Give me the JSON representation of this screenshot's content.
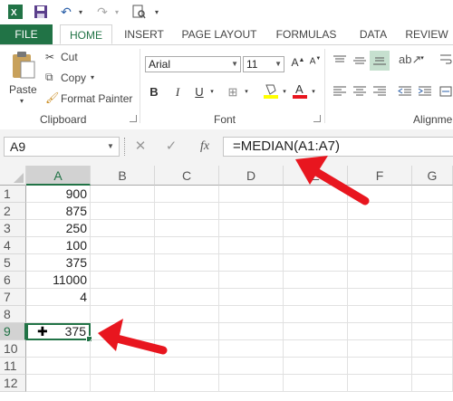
{
  "qat": {
    "save_icon": "save-icon",
    "undo_icon": "undo-icon",
    "redo_icon": "redo-icon",
    "print_preview_icon": "print-preview-icon"
  },
  "tabs": [
    {
      "label": "FILE"
    },
    {
      "label": "HOME"
    },
    {
      "label": "INSERT"
    },
    {
      "label": "PAGE LAYOUT"
    },
    {
      "label": "FORMULAS"
    },
    {
      "label": "DATA"
    },
    {
      "label": "REVIEW"
    }
  ],
  "clipboard": {
    "paste_label": "Paste",
    "cut_label": "Cut",
    "copy_label": "Copy",
    "format_painter_label": "Format Painter",
    "group_label": "Clipboard"
  },
  "font": {
    "font_name": "Arial",
    "font_size": "11",
    "group_label": "Font",
    "bold": "B",
    "italic": "I",
    "underline": "U"
  },
  "alignment": {
    "group_label": "Alignmen"
  },
  "formula_bar": {
    "name_box": "A9",
    "cancel": "✕",
    "enter": "✓",
    "fx": "fx",
    "formula": "=MEDIAN(A1:A7)"
  },
  "grid": {
    "columns": [
      "A",
      "B",
      "C",
      "D",
      "E",
      "F",
      "G"
    ],
    "rows": [
      "1",
      "2",
      "3",
      "4",
      "5",
      "6",
      "7",
      "8",
      "9",
      "10",
      "11",
      "12"
    ],
    "column_a_values": [
      "900",
      "875",
      "250",
      "100",
      "375",
      "11000",
      "4",
      "",
      "375",
      "",
      "",
      ""
    ],
    "selected_cell": "A9"
  },
  "colors": {
    "accent": "#217346",
    "arrow": "#e8161f"
  }
}
